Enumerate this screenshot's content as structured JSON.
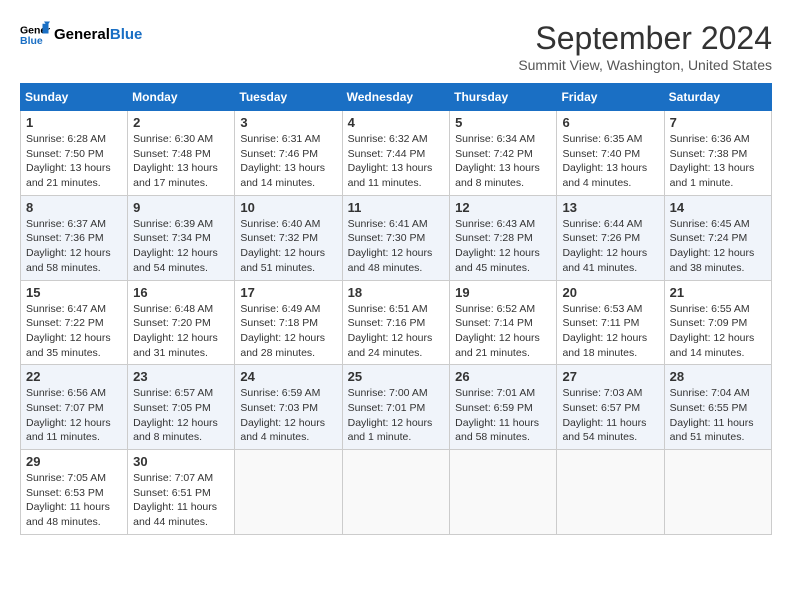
{
  "logo": {
    "text_general": "General",
    "text_blue": "Blue"
  },
  "title": "September 2024",
  "subtitle": "Summit View, Washington, United States",
  "headers": [
    "Sunday",
    "Monday",
    "Tuesday",
    "Wednesday",
    "Thursday",
    "Friday",
    "Saturday"
  ],
  "weeks": [
    [
      {
        "day": "1",
        "sunrise": "Sunrise: 6:28 AM",
        "sunset": "Sunset: 7:50 PM",
        "daylight": "Daylight: 13 hours and 21 minutes."
      },
      {
        "day": "2",
        "sunrise": "Sunrise: 6:30 AM",
        "sunset": "Sunset: 7:48 PM",
        "daylight": "Daylight: 13 hours and 17 minutes."
      },
      {
        "day": "3",
        "sunrise": "Sunrise: 6:31 AM",
        "sunset": "Sunset: 7:46 PM",
        "daylight": "Daylight: 13 hours and 14 minutes."
      },
      {
        "day": "4",
        "sunrise": "Sunrise: 6:32 AM",
        "sunset": "Sunset: 7:44 PM",
        "daylight": "Daylight: 13 hours and 11 minutes."
      },
      {
        "day": "5",
        "sunrise": "Sunrise: 6:34 AM",
        "sunset": "Sunset: 7:42 PM",
        "daylight": "Daylight: 13 hours and 8 minutes."
      },
      {
        "day": "6",
        "sunrise": "Sunrise: 6:35 AM",
        "sunset": "Sunset: 7:40 PM",
        "daylight": "Daylight: 13 hours and 4 minutes."
      },
      {
        "day": "7",
        "sunrise": "Sunrise: 6:36 AM",
        "sunset": "Sunset: 7:38 PM",
        "daylight": "Daylight: 13 hours and 1 minute."
      }
    ],
    [
      {
        "day": "8",
        "sunrise": "Sunrise: 6:37 AM",
        "sunset": "Sunset: 7:36 PM",
        "daylight": "Daylight: 12 hours and 58 minutes."
      },
      {
        "day": "9",
        "sunrise": "Sunrise: 6:39 AM",
        "sunset": "Sunset: 7:34 PM",
        "daylight": "Daylight: 12 hours and 54 minutes."
      },
      {
        "day": "10",
        "sunrise": "Sunrise: 6:40 AM",
        "sunset": "Sunset: 7:32 PM",
        "daylight": "Daylight: 12 hours and 51 minutes."
      },
      {
        "day": "11",
        "sunrise": "Sunrise: 6:41 AM",
        "sunset": "Sunset: 7:30 PM",
        "daylight": "Daylight: 12 hours and 48 minutes."
      },
      {
        "day": "12",
        "sunrise": "Sunrise: 6:43 AM",
        "sunset": "Sunset: 7:28 PM",
        "daylight": "Daylight: 12 hours and 45 minutes."
      },
      {
        "day": "13",
        "sunrise": "Sunrise: 6:44 AM",
        "sunset": "Sunset: 7:26 PM",
        "daylight": "Daylight: 12 hours and 41 minutes."
      },
      {
        "day": "14",
        "sunrise": "Sunrise: 6:45 AM",
        "sunset": "Sunset: 7:24 PM",
        "daylight": "Daylight: 12 hours and 38 minutes."
      }
    ],
    [
      {
        "day": "15",
        "sunrise": "Sunrise: 6:47 AM",
        "sunset": "Sunset: 7:22 PM",
        "daylight": "Daylight: 12 hours and 35 minutes."
      },
      {
        "day": "16",
        "sunrise": "Sunrise: 6:48 AM",
        "sunset": "Sunset: 7:20 PM",
        "daylight": "Daylight: 12 hours and 31 minutes."
      },
      {
        "day": "17",
        "sunrise": "Sunrise: 6:49 AM",
        "sunset": "Sunset: 7:18 PM",
        "daylight": "Daylight: 12 hours and 28 minutes."
      },
      {
        "day": "18",
        "sunrise": "Sunrise: 6:51 AM",
        "sunset": "Sunset: 7:16 PM",
        "daylight": "Daylight: 12 hours and 24 minutes."
      },
      {
        "day": "19",
        "sunrise": "Sunrise: 6:52 AM",
        "sunset": "Sunset: 7:14 PM",
        "daylight": "Daylight: 12 hours and 21 minutes."
      },
      {
        "day": "20",
        "sunrise": "Sunrise: 6:53 AM",
        "sunset": "Sunset: 7:11 PM",
        "daylight": "Daylight: 12 hours and 18 minutes."
      },
      {
        "day": "21",
        "sunrise": "Sunrise: 6:55 AM",
        "sunset": "Sunset: 7:09 PM",
        "daylight": "Daylight: 12 hours and 14 minutes."
      }
    ],
    [
      {
        "day": "22",
        "sunrise": "Sunrise: 6:56 AM",
        "sunset": "Sunset: 7:07 PM",
        "daylight": "Daylight: 12 hours and 11 minutes."
      },
      {
        "day": "23",
        "sunrise": "Sunrise: 6:57 AM",
        "sunset": "Sunset: 7:05 PM",
        "daylight": "Daylight: 12 hours and 8 minutes."
      },
      {
        "day": "24",
        "sunrise": "Sunrise: 6:59 AM",
        "sunset": "Sunset: 7:03 PM",
        "daylight": "Daylight: 12 hours and 4 minutes."
      },
      {
        "day": "25",
        "sunrise": "Sunrise: 7:00 AM",
        "sunset": "Sunset: 7:01 PM",
        "daylight": "Daylight: 12 hours and 1 minute."
      },
      {
        "day": "26",
        "sunrise": "Sunrise: 7:01 AM",
        "sunset": "Sunset: 6:59 PM",
        "daylight": "Daylight: 11 hours and 58 minutes."
      },
      {
        "day": "27",
        "sunrise": "Sunrise: 7:03 AM",
        "sunset": "Sunset: 6:57 PM",
        "daylight": "Daylight: 11 hours and 54 minutes."
      },
      {
        "day": "28",
        "sunrise": "Sunrise: 7:04 AM",
        "sunset": "Sunset: 6:55 PM",
        "daylight": "Daylight: 11 hours and 51 minutes."
      }
    ],
    [
      {
        "day": "29",
        "sunrise": "Sunrise: 7:05 AM",
        "sunset": "Sunset: 6:53 PM",
        "daylight": "Daylight: 11 hours and 48 minutes."
      },
      {
        "day": "30",
        "sunrise": "Sunrise: 7:07 AM",
        "sunset": "Sunset: 6:51 PM",
        "daylight": "Daylight: 11 hours and 44 minutes."
      },
      null,
      null,
      null,
      null,
      null
    ]
  ]
}
